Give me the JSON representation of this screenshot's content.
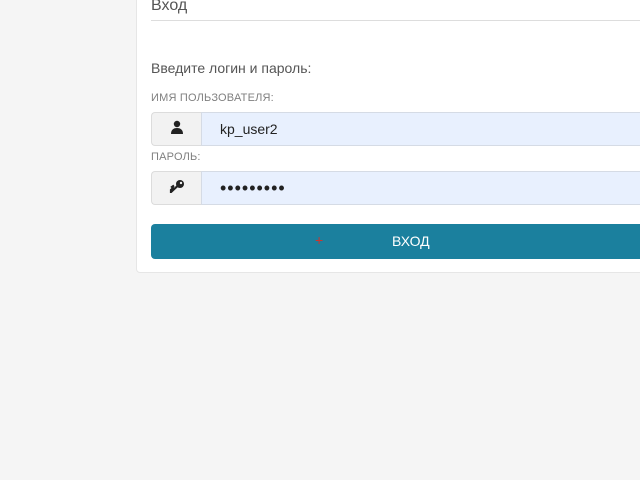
{
  "login": {
    "title": "Вход",
    "prompt": "Введите логин и пароль:",
    "username_label": "ИМЯ ПОЛЬЗОВАТЕЛЯ:",
    "username_value": "kp_user2",
    "password_label": "ПАРОЛЬ:",
    "password_value": "•••••••••",
    "submit_label": "ВХОД",
    "submit_marker": "+",
    "icons": {
      "username": "user-icon",
      "password": "key-icon"
    }
  },
  "colors": {
    "background": "#f5f5f5",
    "card": "#ffffff",
    "input_fill": "#e8f0fe",
    "button": "#1b809e",
    "marker": "#d0342c"
  }
}
